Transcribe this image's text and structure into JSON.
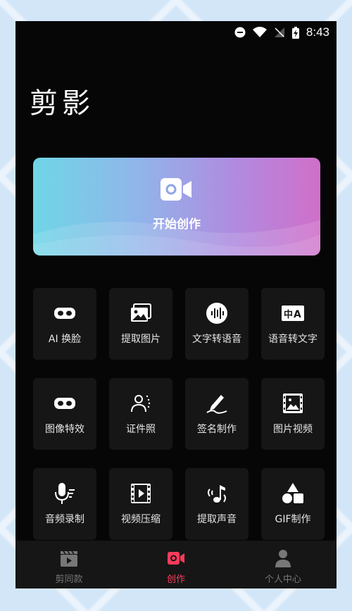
{
  "status_bar": {
    "time": "8:43"
  },
  "app_title": "剪影",
  "hero": {
    "label": "开始创作"
  },
  "tools": [
    {
      "label": "AI 换脸",
      "icon": "mask-icon"
    },
    {
      "label": "提取图片",
      "icon": "images-icon"
    },
    {
      "label": "文字转语音",
      "icon": "audio-wave-icon"
    },
    {
      "label": "语音转文字",
      "icon": "translate-text-icon"
    },
    {
      "label": "图像特效",
      "icon": "mask-icon"
    },
    {
      "label": "证件照",
      "icon": "id-photo-icon"
    },
    {
      "label": "签名制作",
      "icon": "signature-pen-icon"
    },
    {
      "label": "图片视频",
      "icon": "photo-film-icon"
    },
    {
      "label": "音频录制",
      "icon": "microphone-icon"
    },
    {
      "label": "视频压缩",
      "icon": "video-film-icon"
    },
    {
      "label": "提取声音",
      "icon": "music-note-icon"
    },
    {
      "label": "GIF制作",
      "icon": "shapes-icon"
    }
  ],
  "bottom_nav": [
    {
      "label": "剪同款",
      "icon": "clapperboard-icon",
      "active": false
    },
    {
      "label": "创作",
      "icon": "video-camera-icon",
      "active": true
    },
    {
      "label": "个人中心",
      "icon": "person-icon",
      "active": false
    }
  ],
  "colors": {
    "accent": "#ff3b5c",
    "background": "#060606",
    "tile": "#161616"
  }
}
